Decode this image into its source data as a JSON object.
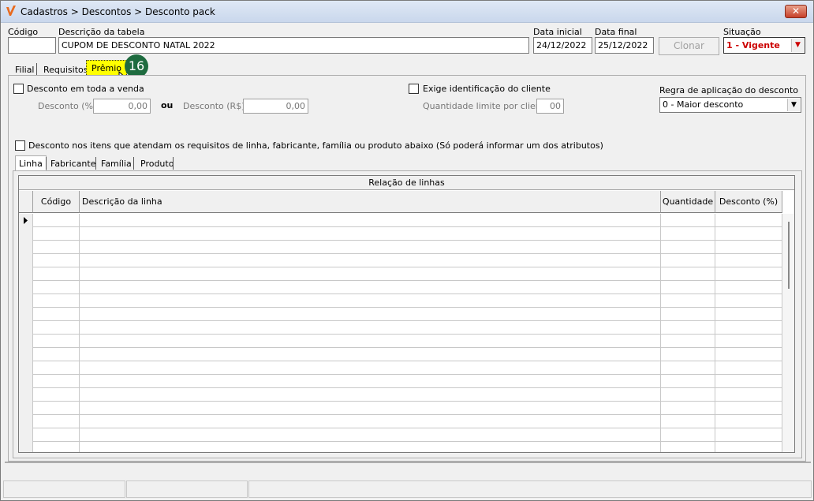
{
  "window": {
    "title": "Cadastros > Descontos > Desconto pack",
    "close": "✕"
  },
  "header": {
    "codigo_label": "Código",
    "codigo_value": "",
    "descricao_label": "Descrição da tabela",
    "descricao_value": "CUPOM DE DESCONTO NATAL 2022",
    "data_inicial_label": "Data inicial",
    "data_inicial_value": "24/12/2022",
    "data_final_label": "Data final",
    "data_final_value": "25/12/2022",
    "clonar_label": "Clonar",
    "situacao_label": "Situação",
    "situacao_value": "1 - Vigente"
  },
  "tabs": [
    {
      "label": "Filial"
    },
    {
      "label": "Requisitos"
    },
    {
      "label": "Prêmio"
    }
  ],
  "badge": "16",
  "premio": {
    "desconto_toda_venda_label": "Desconto em toda a venda",
    "desconto_pct_label": "Desconto (%)",
    "desconto_pct_value": "0,00",
    "ou_label": "ou",
    "desconto_rs_label": "Desconto (R$)",
    "desconto_rs_value": "0,00",
    "exige_id_label": "Exige identificação do cliente",
    "qtd_limite_label": "Quantidade limite por cliente",
    "qtd_limite_value": "00",
    "regra_label": "Regra de aplicação do desconto",
    "regra_value": "0 - Maior desconto",
    "desconto_itens_label": "Desconto nos itens que atendam os requisitos de linha, fabricante, família ou produto abaixo (Só poderá informar um dos atributos)"
  },
  "subtabs": [
    {
      "label": "Linha"
    },
    {
      "label": "Fabricante"
    },
    {
      "label": "Família"
    },
    {
      "label": "Produto"
    }
  ],
  "grid": {
    "title": "Relação de linhas",
    "columns": {
      "codigo": "Código",
      "descricao": "Descrição da linha",
      "quantidade": "Quantidade",
      "desconto": "Desconto (%)"
    },
    "row_count": 18
  },
  "colors": {
    "accent_red": "#cc0000",
    "badge_green": "#1e6b3f",
    "highlight_yellow": "#ffff00"
  }
}
